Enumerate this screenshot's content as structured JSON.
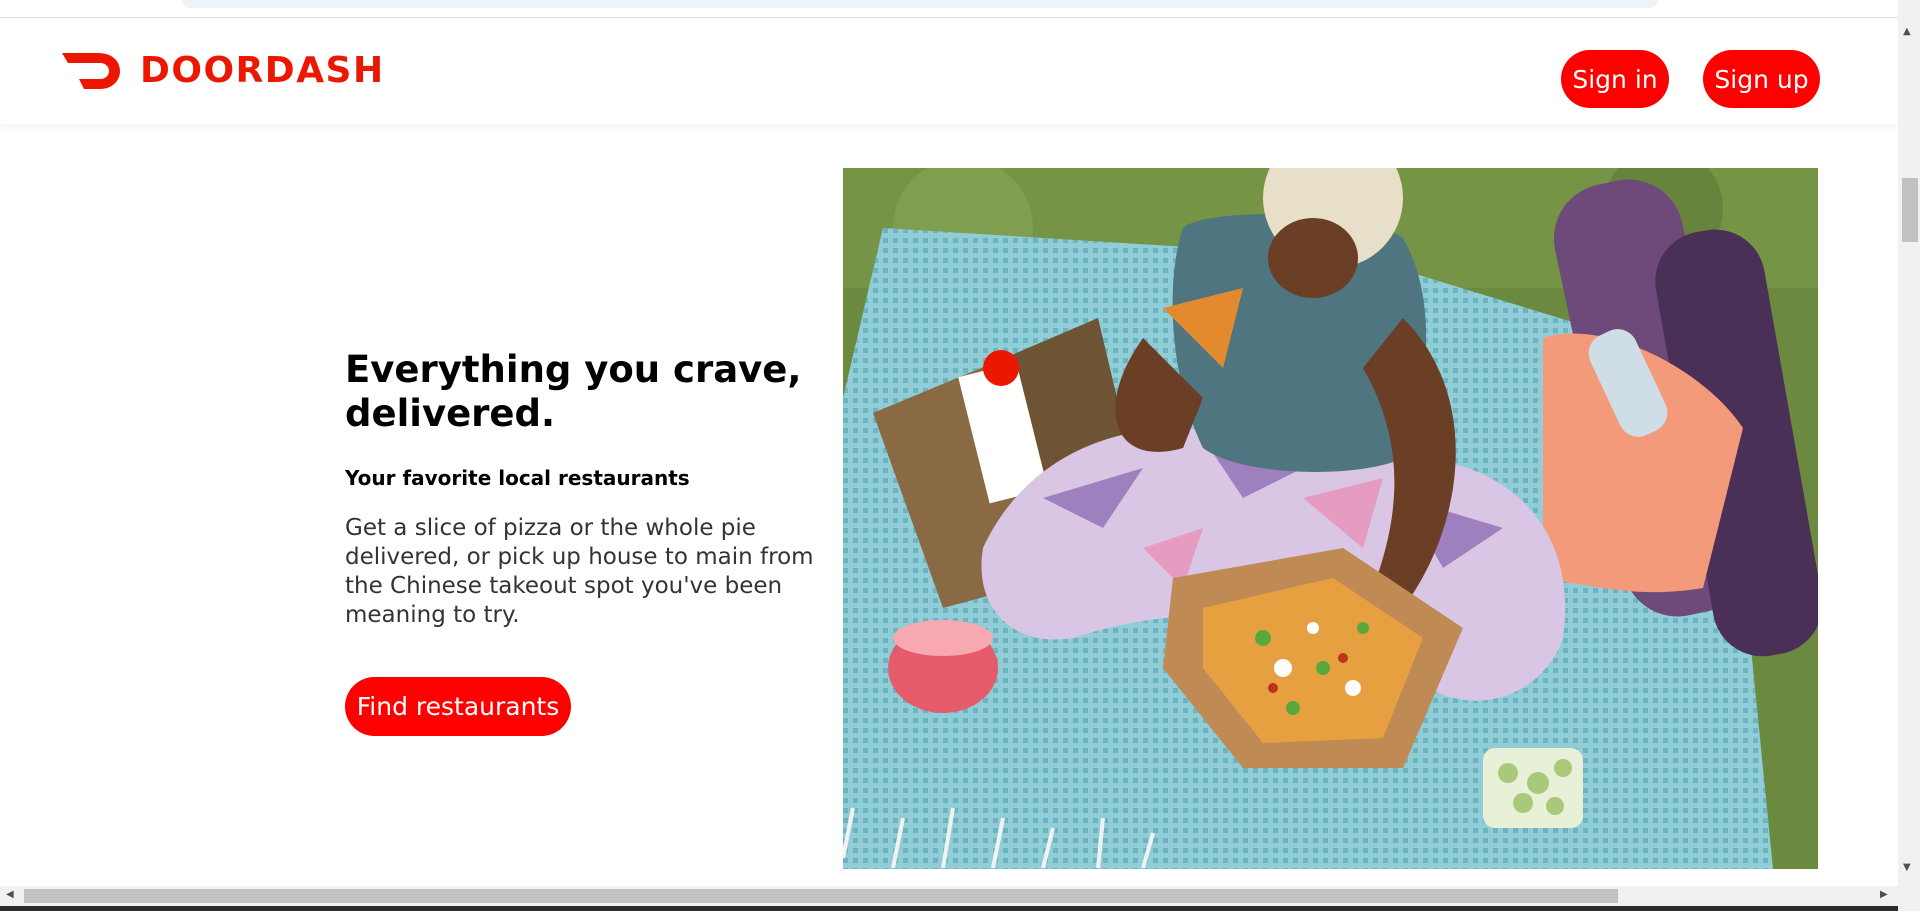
{
  "brand": {
    "name": "DOORDASH",
    "color": "#eb1700"
  },
  "header": {
    "sign_in": "Sign in",
    "sign_up": "Sign up",
    "button_color": "#ff0000"
  },
  "hero": {
    "title": "Everything you crave, delivered.",
    "subtitle": "Your favorite local restaurants",
    "body": "Get a slice of pizza or the whole pie delivered, or pick up house to main from the Chinese takeout spot you've been meaning to try.",
    "cta": "Find restaurants",
    "image_icon": "picnic-photo"
  },
  "scrollbars": {
    "up_icon": "arrow-up-icon",
    "down_icon": "arrow-down-icon",
    "left_icon": "arrow-left-icon",
    "right_icon": "arrow-right-icon"
  }
}
